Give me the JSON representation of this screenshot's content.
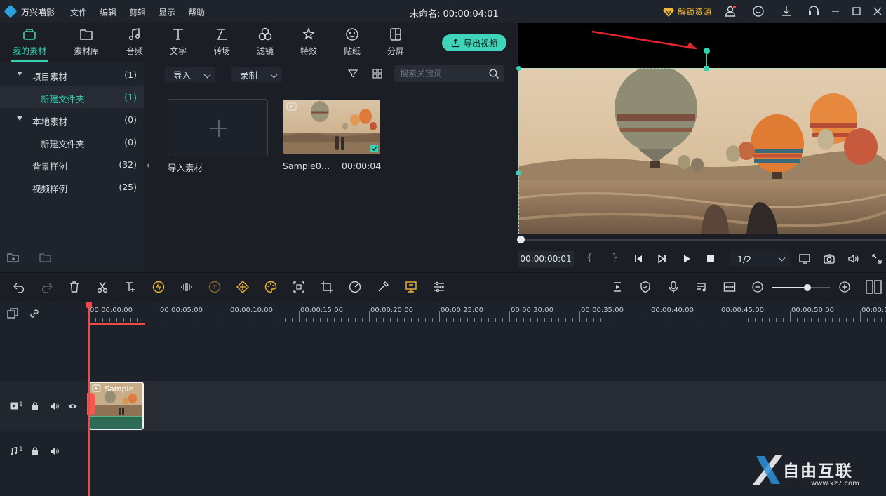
{
  "app": {
    "name": "万兴喵影",
    "doc_title": "未命名: 00:00:04:01"
  },
  "menu": [
    "文件",
    "编辑",
    "剪辑",
    "显示",
    "帮助"
  ],
  "titlebar": {
    "unlock_label": "解锁资源"
  },
  "tabs": [
    {
      "label": "我的素材",
      "icon": "folder-box-icon",
      "active": true
    },
    {
      "label": "素材库",
      "icon": "folder-icon"
    },
    {
      "label": "音频",
      "icon": "music-note-icon"
    },
    {
      "label": "文字",
      "icon": "text-icon"
    },
    {
      "label": "转场",
      "icon": "transition-icon"
    },
    {
      "label": "滤镜",
      "icon": "filter-icon"
    },
    {
      "label": "特效",
      "icon": "effects-icon"
    },
    {
      "label": "贴纸",
      "icon": "sticker-icon"
    },
    {
      "label": "分屏",
      "icon": "split-screen-icon"
    }
  ],
  "export_label": "导出视频",
  "tree": [
    {
      "name": "项目素材",
      "count": "(1)",
      "expandable": true
    },
    {
      "name": "新建文件夹",
      "count": "(1)",
      "selected": true
    },
    {
      "name": "本地素材",
      "count": "(0)",
      "expandable": true
    },
    {
      "name": "新建文件夹",
      "count": "(0)"
    },
    {
      "name": "背景样例",
      "count": "(32)"
    },
    {
      "name": "视频样例",
      "count": "(25)"
    }
  ],
  "media": {
    "import_dropdown": "导入",
    "record_dropdown": "录制",
    "search_placeholder": "搜索关键词",
    "import_tile_label": "导入素材",
    "clip_name": "Sample0…",
    "clip_duration": "00:00:04"
  },
  "preview": {
    "timecode": "00:00:00:01",
    "quality": "1/2"
  },
  "timeline": {
    "ticks": [
      "00:00:00:00",
      "00:00:05:00",
      "00:00:10:00",
      "00:00:15:00",
      "00:00:20:00",
      "00:00:25:00",
      "00:00:30:00",
      "00:00:35:00",
      "00:00:40:00",
      "00:00:45:00",
      "00:00:50:00",
      "00:00:5"
    ],
    "video_track_label": "1",
    "audio_track_label": "1",
    "clip_label": "Sample"
  },
  "watermark": {
    "text": "自由互联",
    "url": "www.xz7.com"
  },
  "colors": {
    "accent": "#37d1b4",
    "playhead": "#ee4a4a",
    "unlock": "#f1b73a"
  }
}
